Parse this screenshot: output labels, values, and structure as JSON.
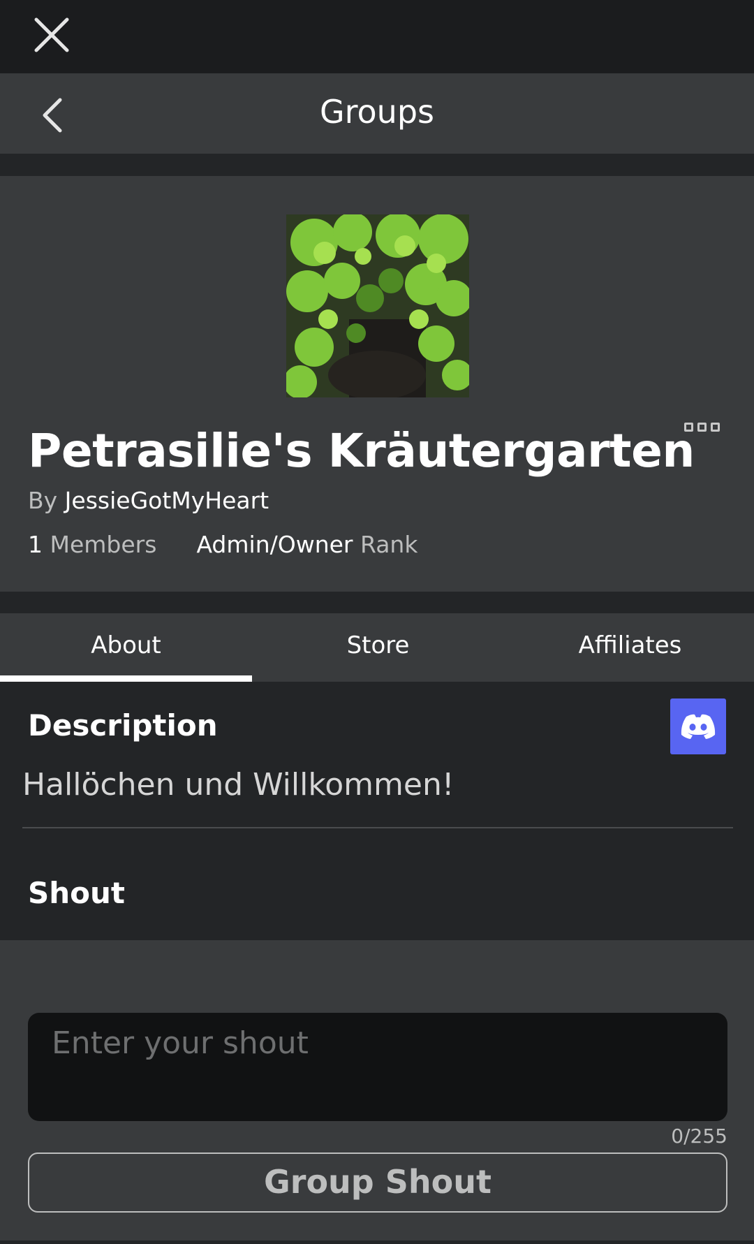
{
  "nav": {
    "title": "Groups"
  },
  "group": {
    "name": "Petrasilie's Kräutergarten",
    "by_label": "By",
    "owner": "JessieGotMyHeart",
    "member_count": "1",
    "members_label": "Members",
    "role": "Admin/Owner",
    "rank_label": "Rank"
  },
  "tabs": [
    {
      "label": "About",
      "active": true
    },
    {
      "label": "Store",
      "active": false
    },
    {
      "label": "Affiliates",
      "active": false
    }
  ],
  "about": {
    "description_title": "Description",
    "description_text": "Hallöchen und Willkommen!",
    "shout_title": "Shout"
  },
  "shout_form": {
    "placeholder": "Enter your shout",
    "char_count": "0/255",
    "button_label": "Group Shout"
  },
  "colors": {
    "discord": "#5865f2",
    "panel": "#393b3d",
    "background": "#232527"
  }
}
